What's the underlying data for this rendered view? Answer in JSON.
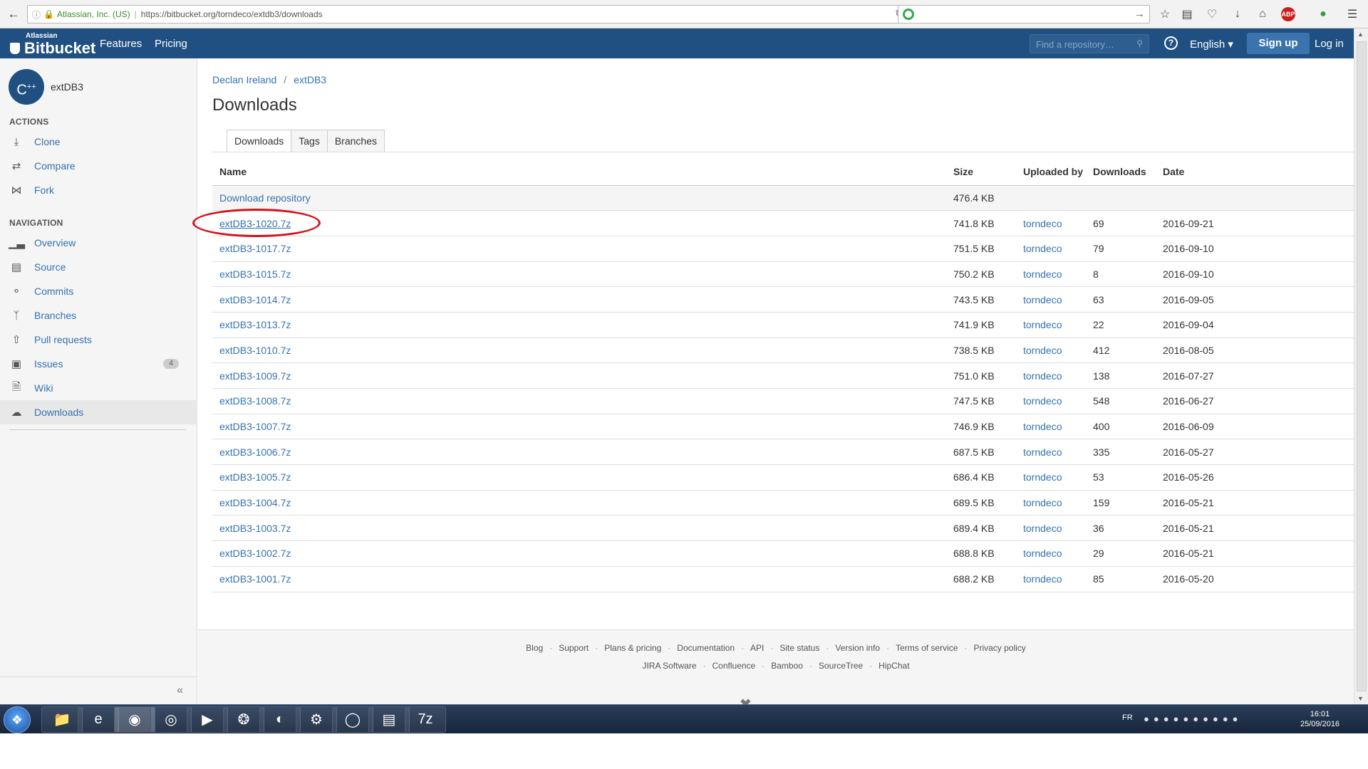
{
  "browser": {
    "org": "Atlassian, Inc. (US)",
    "url": "https://bitbucket.org/torndeco/extdb3/downloads"
  },
  "topnav": {
    "brand_small": "Atlassian",
    "brand": "Bitbucket",
    "features": "Features",
    "pricing": "Pricing",
    "search_placeholder": "Find a repository…",
    "help": "?",
    "language": "English ▾",
    "signup": "Sign up",
    "login": "Log in"
  },
  "sidebar": {
    "avatar_text": "C",
    "avatar_sup": "++",
    "repo_name": "extDB3",
    "actions_heading": "ACTIONS",
    "actions": [
      {
        "label": "Clone",
        "icon": "download-icon"
      },
      {
        "label": "Compare",
        "icon": "compare-icon"
      },
      {
        "label": "Fork",
        "icon": "fork-icon"
      }
    ],
    "navigation_heading": "NAVIGATION",
    "navigation": [
      {
        "label": "Overview",
        "icon": "overview-icon"
      },
      {
        "label": "Source",
        "icon": "source-icon"
      },
      {
        "label": "Commits",
        "icon": "commits-icon"
      },
      {
        "label": "Branches",
        "icon": "branches-icon"
      },
      {
        "label": "Pull requests",
        "icon": "pull-requests-icon"
      },
      {
        "label": "Issues",
        "icon": "issues-icon",
        "badge": "4"
      },
      {
        "label": "Wiki",
        "icon": "wiki-icon"
      },
      {
        "label": "Downloads",
        "icon": "cloud-icon",
        "active": true
      }
    ],
    "collapse": "«"
  },
  "main": {
    "breadcrumb": [
      "Declan Ireland",
      "extDB3"
    ],
    "breadcrumb_sep": "/",
    "title": "Downloads",
    "tabs": [
      "Downloads",
      "Tags",
      "Branches"
    ],
    "columns": [
      "Name",
      "Size",
      "Uploaded by",
      "Downloads",
      "Date"
    ],
    "rows": [
      {
        "name": "Download repository",
        "size": "476.4 KB",
        "uploader": "",
        "downloads": "",
        "date": ""
      },
      {
        "name": "extDB3-1020.7z",
        "size": "741.8 KB",
        "uploader": "torndeco",
        "downloads": "69",
        "date": "2016-09-21"
      },
      {
        "name": "extDB3-1017.7z",
        "size": "751.5 KB",
        "uploader": "torndeco",
        "downloads": "79",
        "date": "2016-09-10"
      },
      {
        "name": "extDB3-1015.7z",
        "size": "750.2 KB",
        "uploader": "torndeco",
        "downloads": "8",
        "date": "2016-09-10"
      },
      {
        "name": "extDB3-1014.7z",
        "size": "743.5 KB",
        "uploader": "torndeco",
        "downloads": "63",
        "date": "2016-09-05"
      },
      {
        "name": "extDB3-1013.7z",
        "size": "741.9 KB",
        "uploader": "torndeco",
        "downloads": "22",
        "date": "2016-09-04"
      },
      {
        "name": "extDB3-1010.7z",
        "size": "738.5 KB",
        "uploader": "torndeco",
        "downloads": "412",
        "date": "2016-08-05"
      },
      {
        "name": "extDB3-1009.7z",
        "size": "751.0 KB",
        "uploader": "torndeco",
        "downloads": "138",
        "date": "2016-07-27"
      },
      {
        "name": "extDB3-1008.7z",
        "size": "747.5 KB",
        "uploader": "torndeco",
        "downloads": "548",
        "date": "2016-06-27"
      },
      {
        "name": "extDB3-1007.7z",
        "size": "746.9 KB",
        "uploader": "torndeco",
        "downloads": "400",
        "date": "2016-06-09"
      },
      {
        "name": "extDB3-1006.7z",
        "size": "687.5 KB",
        "uploader": "torndeco",
        "downloads": "335",
        "date": "2016-05-27"
      },
      {
        "name": "extDB3-1005.7z",
        "size": "686.4 KB",
        "uploader": "torndeco",
        "downloads": "53",
        "date": "2016-05-26"
      },
      {
        "name": "extDB3-1004.7z",
        "size": "689.5 KB",
        "uploader": "torndeco",
        "downloads": "159",
        "date": "2016-05-21"
      },
      {
        "name": "extDB3-1003.7z",
        "size": "689.4 KB",
        "uploader": "torndeco",
        "downloads": "36",
        "date": "2016-05-21"
      },
      {
        "name": "extDB3-1002.7z",
        "size": "688.8 KB",
        "uploader": "torndeco",
        "downloads": "29",
        "date": "2016-05-21"
      },
      {
        "name": "extDB3-1001.7z",
        "size": "688.2 KB",
        "uploader": "torndeco",
        "downloads": "85",
        "date": "2016-05-20"
      }
    ]
  },
  "footer": {
    "row1": [
      "Blog",
      "Support",
      "Plans & pricing",
      "Documentation",
      "API",
      "Site status",
      "Version info",
      "Terms of service",
      "Privacy policy"
    ],
    "row2": [
      "JIRA Software",
      "Confluence",
      "Bamboo",
      "SourceTree",
      "HipChat"
    ]
  },
  "taskbar": {
    "lang": "FR",
    "time": "16:01",
    "date": "25/09/2016",
    "apps": [
      "explorer-icon",
      "ie-icon",
      "firefox-icon",
      "chrome-icon",
      "media-player-icon",
      "network-icon",
      "app-icon",
      "steam-icon",
      "disc-icon",
      "notes-icon",
      "7zip-icon"
    ]
  },
  "colors": {
    "topnav": "#205081",
    "link": "#3572b0",
    "highlight_circle": "#d2111b"
  }
}
